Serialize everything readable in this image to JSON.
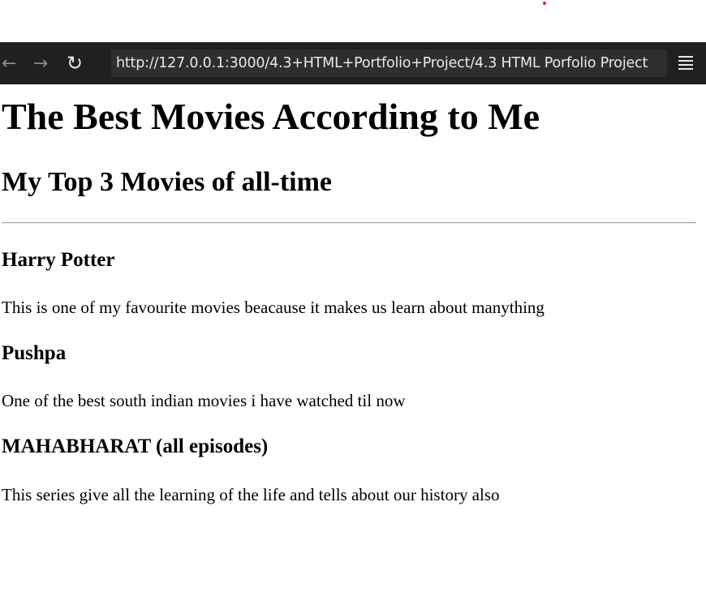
{
  "browser": {
    "back_icon": "←",
    "forward_icon": "→",
    "reload_icon": "↻",
    "url": "http://127.0.0.1:3000/4.3+HTML+Portfolio+Project/4.3 HTML Porfolio Project",
    "menu_icon": "menu-icon"
  },
  "page": {
    "title": "The Best Movies According to Me",
    "subtitle": "My Top 3 Movies of all-time",
    "movies": [
      {
        "title": "Harry Potter",
        "description": "This is one of my favourite movies beacause it makes us learn about manything"
      },
      {
        "title": "Pushpa",
        "description": "One of the best south indian movies i have watched til now"
      },
      {
        "title": "MAHABHARAT (all episodes)",
        "description": "This series give all the learning of the life and tells about our history also"
      }
    ]
  }
}
